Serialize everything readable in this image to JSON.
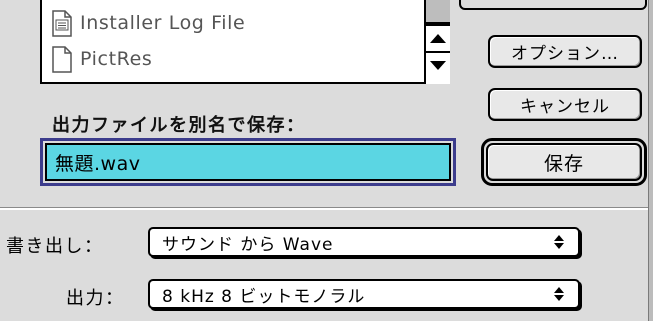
{
  "file_list": {
    "items": [
      {
        "label": "Installer Log File",
        "icon": "document-lines-icon"
      },
      {
        "label": "PictRes",
        "icon": "blank-document-icon"
      }
    ]
  },
  "buttons": {
    "options": "オプション…",
    "cancel": "キャンセル",
    "save": "保存"
  },
  "save_as": {
    "label": "出力ファイルを別名で保存：",
    "value": "無題.wav"
  },
  "export": {
    "label": "書き出し：",
    "value": "サウンド から Wave"
  },
  "output": {
    "label": "出力：",
    "value": "8 kHz 8 ビットモノラル"
  },
  "colors": {
    "filename_highlight": "#5bd6e3",
    "focus_ring": "#3c3c8c",
    "dialog_background": "#dcdcdc"
  }
}
